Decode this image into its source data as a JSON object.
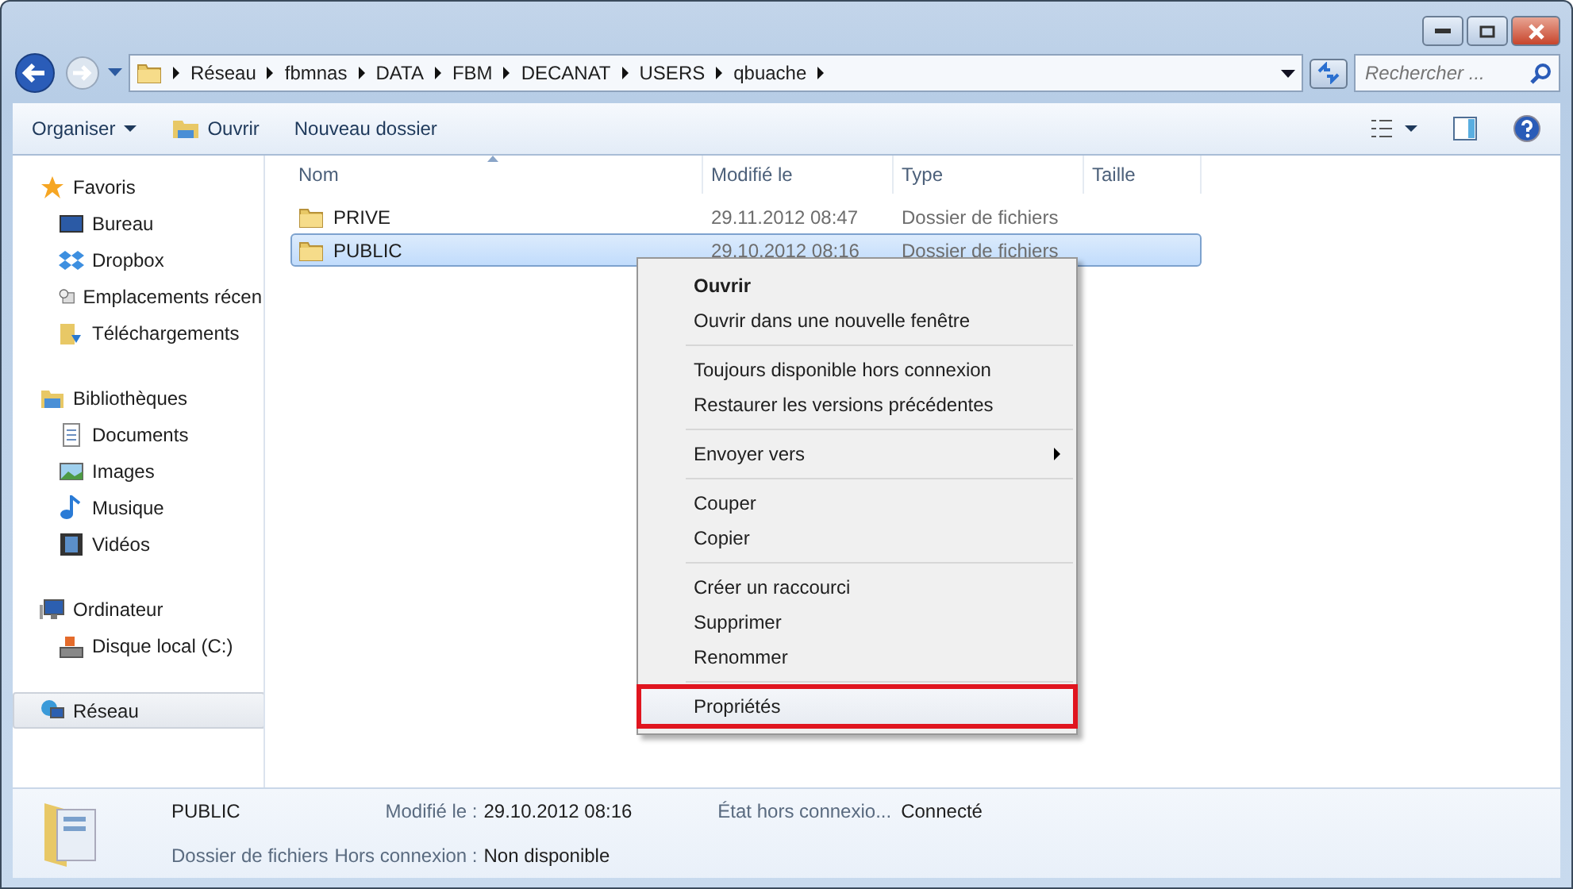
{
  "address": {
    "segments": [
      "Réseau",
      "fbmnas",
      "DATA",
      "FBM",
      "DECANAT",
      "USERS",
      "qbuache"
    ]
  },
  "search": {
    "placeholder": "Rechercher ..."
  },
  "toolbar": {
    "items": [
      {
        "label": "Organiser",
        "kind": "menu"
      },
      {
        "label": "Ouvrir",
        "kind": "open"
      },
      {
        "label": "Nouveau dossier",
        "kind": "plain"
      }
    ]
  },
  "sidebar": {
    "groups": [
      {
        "label": "Favoris",
        "selected": false,
        "children": [
          {
            "label": "Bureau",
            "selected": false
          },
          {
            "label": "Dropbox",
            "selected": false
          },
          {
            "label": "Emplacements récen",
            "selected": false
          },
          {
            "label": "Téléchargements",
            "selected": false
          }
        ]
      },
      {
        "label": "Bibliothèques",
        "selected": false,
        "children": [
          {
            "label": "Documents",
            "selected": false
          },
          {
            "label": "Images",
            "selected": false
          },
          {
            "label": "Musique",
            "selected": false
          },
          {
            "label": "Vidéos",
            "selected": false
          }
        ]
      },
      {
        "label": "Ordinateur",
        "selected": false,
        "children": [
          {
            "label": "Disque local (C:)",
            "selected": false
          }
        ]
      },
      {
        "label": "Réseau",
        "selected": true
      }
    ]
  },
  "table": {
    "columns": [
      {
        "label": "Nom",
        "sorted": true
      },
      {
        "label": "Modifié le",
        "sorted": false
      },
      {
        "label": "Type",
        "sorted": false
      },
      {
        "label": "Taille",
        "sorted": false
      }
    ],
    "rows": [
      {
        "name": "PRIVE",
        "modified": "29.11.2012 08:47",
        "type": "Dossier de fichiers",
        "selected": false
      },
      {
        "name": "PUBLIC",
        "modified": "29.10.2012 08:16",
        "type": "Dossier de fichiers",
        "selected": true
      }
    ]
  },
  "context_menu": {
    "groups": [
      [
        {
          "label": "Ouvrir",
          "bold": true,
          "submenu": false,
          "highlighted": false
        },
        {
          "label": "Ouvrir dans une nouvelle fenêtre",
          "bold": false,
          "submenu": false,
          "highlighted": false
        }
      ],
      [
        {
          "label": "Toujours disponible hors connexion",
          "bold": false,
          "submenu": false,
          "highlighted": false
        },
        {
          "label": "Restaurer les versions précédentes",
          "bold": false,
          "submenu": false,
          "highlighted": false
        }
      ],
      [
        {
          "label": "Envoyer vers",
          "bold": false,
          "submenu": true,
          "highlighted": false
        }
      ],
      [
        {
          "label": "Couper",
          "bold": false,
          "submenu": false,
          "highlighted": false
        },
        {
          "label": "Copier",
          "bold": false,
          "submenu": false,
          "highlighted": false
        }
      ],
      [
        {
          "label": "Créer un raccourci",
          "bold": false,
          "submenu": false,
          "highlighted": false
        },
        {
          "label": "Supprimer",
          "bold": false,
          "submenu": false,
          "highlighted": false
        },
        {
          "label": "Renommer",
          "bold": false,
          "submenu": false,
          "highlighted": false
        }
      ],
      [
        {
          "label": "Propriétés",
          "bold": false,
          "submenu": false,
          "highlighted": true
        }
      ]
    ]
  },
  "details": {
    "name": "PUBLIC",
    "type": "Dossier de fichiers",
    "fields": [
      {
        "label": "Modifié le :",
        "value": "29.10.2012 08:16"
      },
      {
        "label": "Hors connexion :",
        "value": "Non disponible"
      },
      {
        "label": "État hors connexio...",
        "value": "Connecté"
      }
    ]
  }
}
